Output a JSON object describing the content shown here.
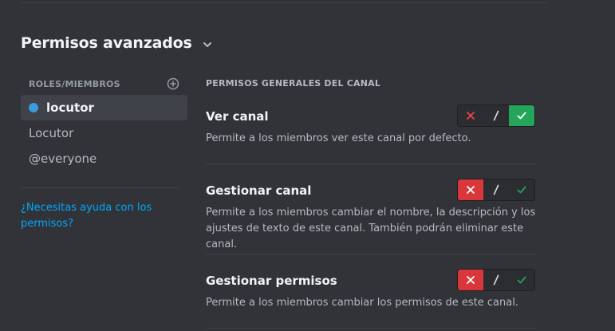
{
  "section": {
    "title": "Permisos avanzados",
    "expand_icon": "chevron-down-icon"
  },
  "sidebar": {
    "header": "ROLES/MIEMBROS",
    "add_icon": "plus-circle-icon",
    "roles": [
      {
        "label": "locutor",
        "selected": true,
        "dot_color": "#3c9bdc"
      },
      {
        "label": "Locutor",
        "selected": false
      },
      {
        "label": "@everyone",
        "selected": false
      }
    ],
    "help_link": "¿Necesitas ayuda con los permisos?"
  },
  "permissions": {
    "section_label": "PERMISOS GENERALES DEL CANAL",
    "items": [
      {
        "name": "Ver canal",
        "description": "Permite a los miembros ver este canal por defecto.",
        "state": "allow"
      },
      {
        "name": "Gestionar canal",
        "description": "Permite a los miembros cambiar el nombre, la descripción y los ajustes de texto de este canal. También podrán eliminar este canal.",
        "state": "deny"
      },
      {
        "name": "Gestionar permisos",
        "description": "Permite a los miembros cambiar los permisos de este canal.",
        "state": "deny"
      }
    ]
  },
  "colors": {
    "background": "#313338",
    "selected_row": "#404249",
    "deny_active": "#da373c",
    "allow_active": "#23a55a",
    "link": "#00a8fc"
  }
}
